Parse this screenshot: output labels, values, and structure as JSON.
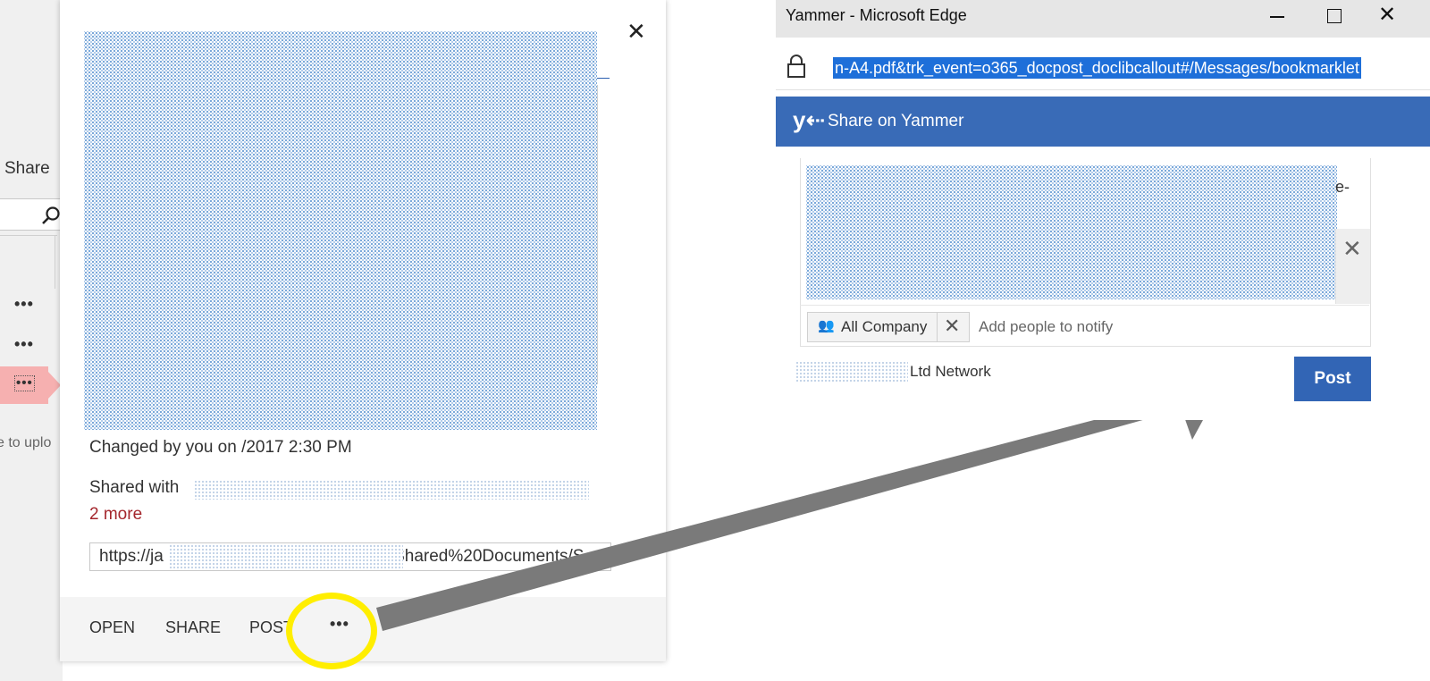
{
  "sharepoint": {
    "share_label": "Share",
    "row_actions": [
      "•••",
      "•••"
    ],
    "selected_action": "•••",
    "upload_hint": "e to uplo"
  },
  "callout": {
    "close_glyph": "✕",
    "changed_text": "Changed by you on        /2017 2:30 PM",
    "shared_with_text": "Shared with",
    "more_link": "2 more",
    "url_prefix": "https://ja",
    "url_suffix": "/Shared%20Documents/S",
    "footer": {
      "open": "OPEN",
      "share": "SHARE",
      "post": "POST",
      "more": "•••"
    },
    "highlight_color": "#ffee00"
  },
  "edge": {
    "window_title": "Yammer - Microsoft Edge",
    "min_glyph": "",
    "close_glyph": "✕",
    "address_text": "n-A4.pdf&trk_event=o365_docpost_doclibcallout#/Messages/bookmarklet",
    "accent": "#1e6fd9"
  },
  "yammer": {
    "logo_glyph": "y⇠",
    "title": "Share on Yammer",
    "compose_trailing": "e-",
    "attachment_remove_glyph": "✕",
    "group_icon": "👥",
    "group_label": "All Company",
    "group_remove_glyph": "✕",
    "notify_placeholder": "Add people to notify",
    "network_label": "Ltd Network",
    "post_button": "Post",
    "brand_color": "#396bb7"
  },
  "arrow_color": "#7a7a7a"
}
